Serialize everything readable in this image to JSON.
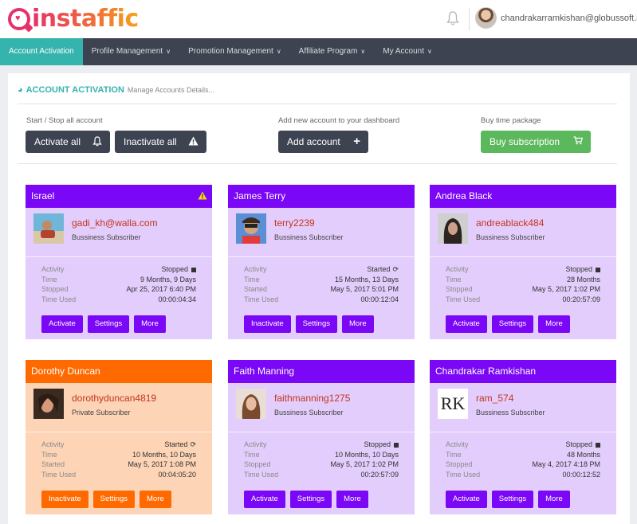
{
  "header": {
    "logo_text": "instaffic",
    "user_email": "chandrakarramkishan@globussoft.in"
  },
  "nav": [
    {
      "label": "Account Activation",
      "active": true,
      "caret": false
    },
    {
      "label": "Profile Management",
      "active": false,
      "caret": true
    },
    {
      "label": "Promotion Management",
      "active": false,
      "caret": true
    },
    {
      "label": "Affiliate Program",
      "active": false,
      "caret": true
    },
    {
      "label": "My Account",
      "active": false,
      "caret": true
    }
  ],
  "page": {
    "title": "ACCOUNT ACTIVATION",
    "subtitle": "Manage Accounts Details..."
  },
  "toolbar": {
    "start_stop_label": "Start / Stop all account",
    "activate_all": "Activate all",
    "inactivate_all": "Inactivate all",
    "add_account_label": "Add new account to your dashboard",
    "add_account": "Add account",
    "buy_time_label": "Buy time package",
    "buy_subscription": "Buy subscription"
  },
  "colors": {
    "teal": "#35b3ad",
    "purple": "#7a07f5",
    "orange": "#ff6a00",
    "green": "#5cb85c",
    "dark": "#3d4350"
  },
  "stat_labels": {
    "activity": "Activity",
    "time": "Time",
    "stopped": "Stopped",
    "started": "Started",
    "time_used": "Time Used"
  },
  "buttons": {
    "activate": "Activate",
    "inactivate": "Inactivate",
    "settings": "Settings",
    "more": "More"
  },
  "accounts": [
    {
      "name": "Israel",
      "username": "gadi_kh@walla.com",
      "type": "Bussiness Subscriber",
      "activity": "Stopped",
      "time": "9 Months, 9 Days",
      "date_label": "Stopped",
      "date": "Apr 25, 2017 6:40 PM",
      "time_used": "00:00:04:34",
      "action": "Activate",
      "theme": "purple",
      "warning": true
    },
    {
      "name": "James Terry",
      "username": "terry2239",
      "type": "Bussiness Subscriber",
      "activity": "Started",
      "time": "15 Months, 13 Days",
      "date_label": "Started",
      "date": "May 5, 2017 5:01 PM",
      "time_used": "00:00:12:04",
      "action": "Inactivate",
      "theme": "purple",
      "warning": false
    },
    {
      "name": "Andrea Black",
      "username": "andreablack484",
      "type": "Bussiness Subscriber",
      "activity": "Stopped",
      "time": "28 Months",
      "date_label": "Stopped",
      "date": "May 5, 2017 1:02 PM",
      "time_used": "00:20:57:09",
      "action": "Activate",
      "theme": "purple",
      "warning": false
    },
    {
      "name": "Dorothy Duncan",
      "username": "dorothyduncan4819",
      "type": "Private Subscriber",
      "activity": "Started",
      "time": "10 Months, 10 Days",
      "date_label": "Started",
      "date": "May 5, 2017 1:08 PM",
      "time_used": "00:04:05:20",
      "action": "Inactivate",
      "theme": "orange",
      "warning": false
    },
    {
      "name": "Faith Manning",
      "username": "faithmanning1275",
      "type": "Bussiness Subscriber",
      "activity": "Stopped",
      "time": "10 Months, 10 Days",
      "date_label": "Stopped",
      "date": "May 5, 2017 1:02 PM",
      "time_used": "00:20:57:09",
      "action": "Activate",
      "theme": "purple",
      "warning": false
    },
    {
      "name": "Chandrakar Ramkishan",
      "username": "ram_574",
      "type": "Bussiness Subscriber",
      "activity": "Stopped",
      "time": "48 Months",
      "date_label": "Stopped",
      "date": "May 4, 2017 4:18 PM",
      "time_used": "00:00:12:52",
      "action": "Activate",
      "theme": "purple",
      "warning": false,
      "thumb_text": "RK"
    }
  ]
}
